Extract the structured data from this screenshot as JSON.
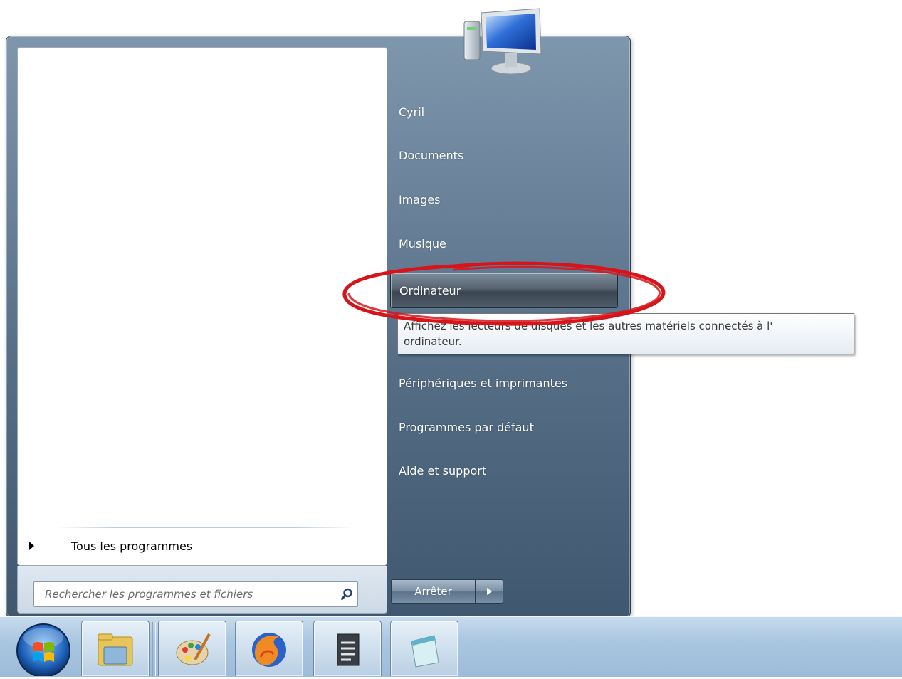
{
  "start_menu": {
    "left": {
      "all_programs_label": "Tous les programmes",
      "search_placeholder": "Rechercher les programmes et fichiers"
    },
    "right": {
      "items": [
        {
          "label": "Cyril"
        },
        {
          "label": "Documents"
        },
        {
          "label": "Images"
        },
        {
          "label": "Musique"
        },
        {
          "label": "Ordinateur",
          "hovered": true
        },
        {
          "label": "Périphériques et imprimantes"
        },
        {
          "label": "Programmes par défaut"
        },
        {
          "label": "Aide et support"
        }
      ],
      "tooltip_line1": "Affichez les lecteurs de disques et les autres matériels connectés à l'",
      "tooltip_line2": "ordinateur.",
      "shutdown_label": "Arrêter"
    }
  },
  "taskbar": {
    "pinned_icons": [
      "explorer-icon",
      "paint-icon",
      "firefox-icon",
      "wordpad-icon",
      "notepad-icon"
    ]
  },
  "colors": {
    "menu_blue": "#566f87",
    "highlight_red": "#d8141b",
    "taskbar_blue": "#aac6e1"
  }
}
